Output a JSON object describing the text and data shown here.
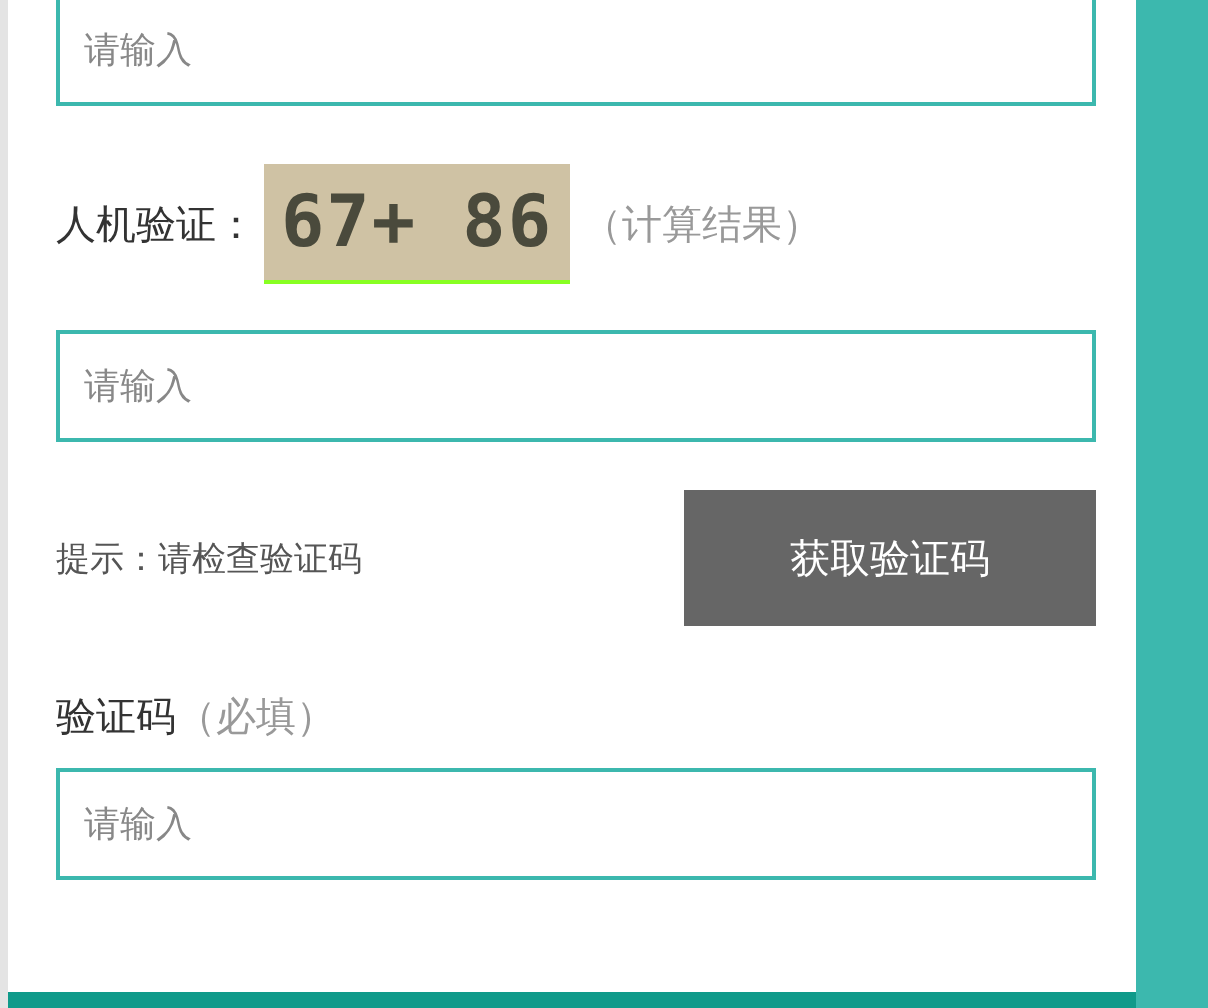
{
  "fields": [
    {
      "placeholder": "请输入"
    }
  ],
  "captcha": {
    "label": "人机验证：",
    "code": "67+ 86",
    "note": "（计算结果）"
  },
  "captcha_field": {
    "placeholder": "请输入"
  },
  "hint": "提示：请检查验证码",
  "get_code_button": "获取验证码",
  "code_label": {
    "label": "验证码",
    "note": "（必填）"
  },
  "code_field": {
    "placeholder": "请输入"
  }
}
